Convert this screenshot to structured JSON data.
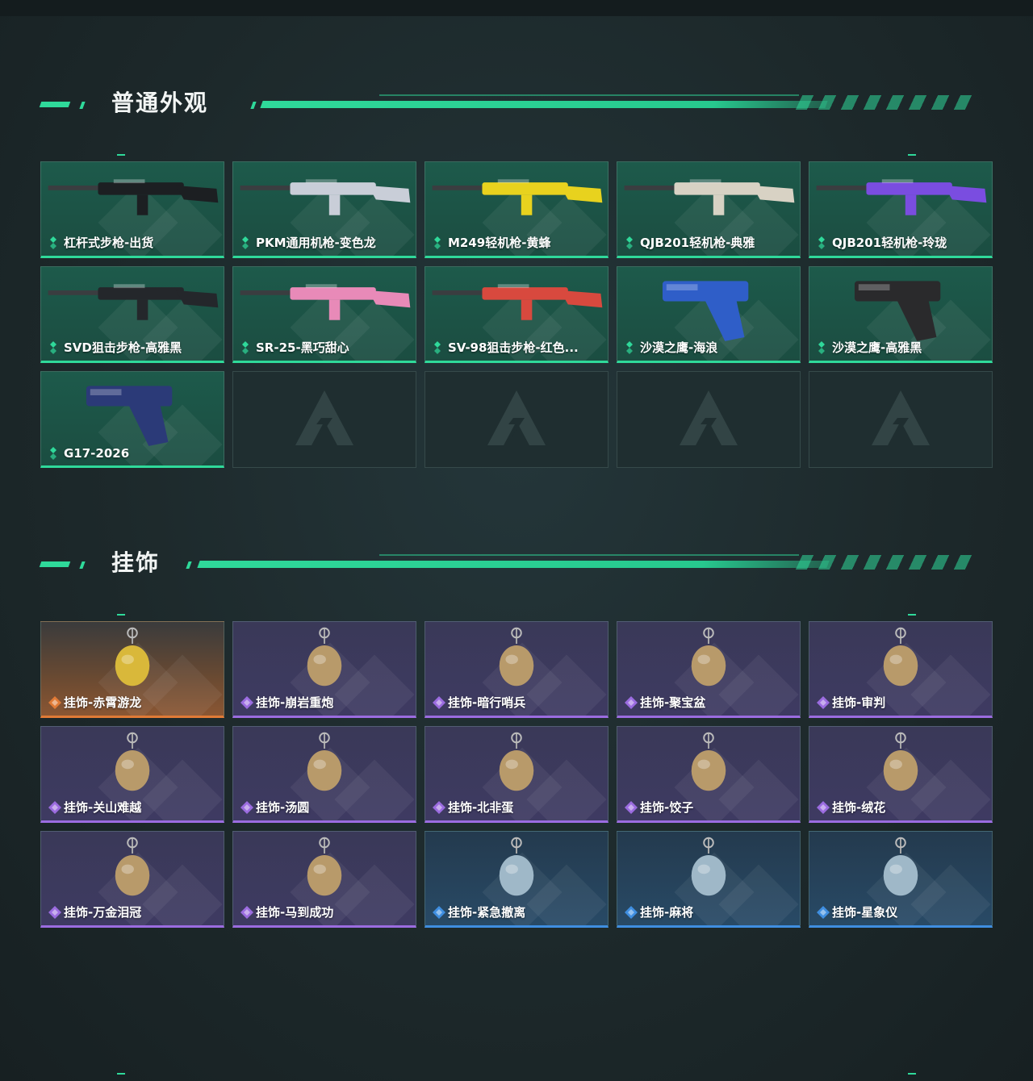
{
  "colors": {
    "accent_green": "#2fd99a",
    "rarity_orange": "#e07a36",
    "rarity_purple": "#9b6ce0",
    "rarity_blue": "#3f8ee0"
  },
  "sections": {
    "skins": {
      "title": "普通外观",
      "items": [
        {
          "name": "杠杆式步枪-出货",
          "rarity": "green",
          "icon": "lever-rifle-icon"
        },
        {
          "name": "PKM通用机枪-变色龙",
          "rarity": "green",
          "icon": "machine-gun-icon"
        },
        {
          "name": "M249轻机枪-黄蜂",
          "rarity": "green",
          "icon": "light-machine-gun-icon"
        },
        {
          "name": "QJB201轻机枪-典雅",
          "rarity": "green",
          "icon": "light-machine-gun-icon"
        },
        {
          "name": "QJB201轻机枪-玲珑",
          "rarity": "green",
          "icon": "light-machine-gun-icon"
        },
        {
          "name": "SVD狙击步枪-高雅黑",
          "rarity": "green",
          "icon": "sniper-rifle-icon"
        },
        {
          "name": "SR-25-黑巧甜心",
          "rarity": "green",
          "icon": "rifle-icon"
        },
        {
          "name": "SV-98狙击步枪-红色...",
          "rarity": "green",
          "icon": "sniper-rifle-icon"
        },
        {
          "name": "沙漠之鹰-海浪",
          "rarity": "green",
          "icon": "pistol-icon"
        },
        {
          "name": "沙漠之鹰-高雅黑",
          "rarity": "green",
          "icon": "pistol-icon"
        },
        {
          "name": "G17-2026",
          "rarity": "green",
          "icon": "pistol-icon"
        }
      ],
      "empty_slots": 4
    },
    "charms": {
      "title": "挂饰",
      "items": [
        {
          "name": "挂饰-赤霄游龙",
          "rarity": "orange",
          "icon": "dragon-charm-icon"
        },
        {
          "name": "挂饰-崩岩重炮",
          "rarity": "purple",
          "icon": "figure-charm-icon"
        },
        {
          "name": "挂饰-暗行哨兵",
          "rarity": "purple",
          "icon": "figure-charm-icon"
        },
        {
          "name": "挂饰-聚宝盆",
          "rarity": "purple",
          "icon": "treasure-bowl-charm-icon"
        },
        {
          "name": "挂饰-审判",
          "rarity": "purple",
          "icon": "card-charm-icon"
        },
        {
          "name": "挂饰-关山难越",
          "rarity": "purple",
          "icon": "gold-bar-charm-icon"
        },
        {
          "name": "挂饰-汤圆",
          "rarity": "purple",
          "icon": "bowl-charm-icon"
        },
        {
          "name": "挂饰-北非蛋",
          "rarity": "purple",
          "icon": "pan-charm-icon"
        },
        {
          "name": "挂饰-饺子",
          "rarity": "purple",
          "icon": "dumpling-charm-icon"
        },
        {
          "name": "挂饰-绒花",
          "rarity": "purple",
          "icon": "flower-charm-icon"
        },
        {
          "name": "挂饰-万金泪冠",
          "rarity": "purple",
          "icon": "crown-charm-icon"
        },
        {
          "name": "挂饰-马到成功",
          "rarity": "purple",
          "icon": "horse-charm-icon"
        },
        {
          "name": "挂饰-紧急撤离",
          "rarity": "blue",
          "icon": "tag-charm-icon"
        },
        {
          "name": "挂饰-麻将",
          "rarity": "blue",
          "icon": "mahjong-charm-icon"
        },
        {
          "name": "挂饰-星象仪",
          "rarity": "blue",
          "icon": "astrolabe-charm-icon"
        }
      ]
    }
  }
}
